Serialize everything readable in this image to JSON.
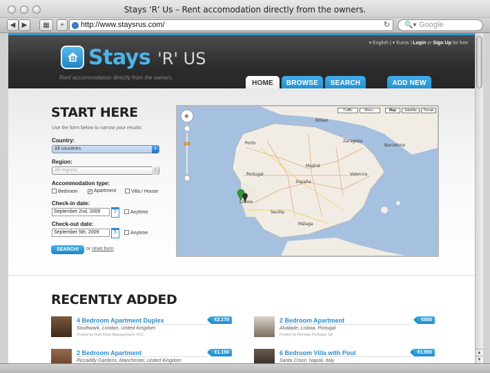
{
  "browser": {
    "window_title": "Stays ‘R’ Us – Rent accomodation directly from the owners.",
    "url": "http://www.staysrus.com/",
    "search_placeholder": "Google"
  },
  "site": {
    "logo_main": "Stays",
    "logo_suffix": "'R' US",
    "tagline": "Rent accommodation directly from the owners.",
    "top_links": {
      "language": "English",
      "currency": "Euros",
      "login": "Login",
      "or": "or",
      "signup": "Sign Up",
      "signup_suffix": "for free"
    },
    "nav": [
      "HOME",
      "BROWSE",
      "SEARCH",
      "ADD NEW"
    ],
    "active_nav": "HOME"
  },
  "form": {
    "title": "START HERE",
    "intro": "Use the form below to narrow your results:",
    "country_label": "Country:",
    "country_value": "All countries",
    "region_label": "Region:",
    "region_value": "All regions",
    "accommodation_label": "Accommodation type:",
    "types": [
      {
        "label": "Bedroom",
        "checked": false
      },
      {
        "label": "Apartment",
        "checked": true
      },
      {
        "label": "Villa / House",
        "checked": false
      }
    ],
    "checkin_label": "Check-in date:",
    "checkin_value": "September 2nd, 2009",
    "checkin_day": "2",
    "checkout_label": "Check-out date:",
    "checkout_value": "September 5th, 2009",
    "checkout_day": "5",
    "anytime_label": "Anytime",
    "search_button": "SEARCH!",
    "or_text": "or",
    "reset_link": "reset form"
  },
  "map": {
    "buttons": [
      "Traffic",
      "More...",
      "Map",
      "Satellite",
      "Terrain"
    ],
    "selected": "Map",
    "labels": [
      "España",
      "Madrid",
      "Portugal",
      "Lisboa",
      "Barcelona",
      "Valencia",
      "Sevilla",
      "Málaga",
      "Zaragoza",
      "Porto",
      "Bilbao"
    ]
  },
  "recent": {
    "title": "RECENTLY ADDED",
    "listings": [
      {
        "title": "4 Bedroom Apartment Duplex",
        "location": "Southwark, London, United Kingdom",
        "posted": "Posted by Red Rock Management, PLC",
        "price": "€2.170"
      },
      {
        "title": "2 Bedroom Apartment",
        "location": "Alvalade, Lisboa, Portugal",
        "posted": "Posted by Re/max Portugal, SA",
        "price": "€800"
      },
      {
        "title": "2 Bedroom Apartment",
        "location": "Piccadilly Gardens, Manchester, United Kingdom",
        "posted": "",
        "price": "€1.150"
      },
      {
        "title": "6 Bedroom Villa with Pool",
        "location": "Santa Croce, Napoli, Italy",
        "posted": "",
        "price": "€1.950"
      }
    ]
  },
  "colors": {
    "accent": "#2a9bd8",
    "header_dark": "#2c2c2c",
    "price_tag": "#1c8ccd"
  }
}
